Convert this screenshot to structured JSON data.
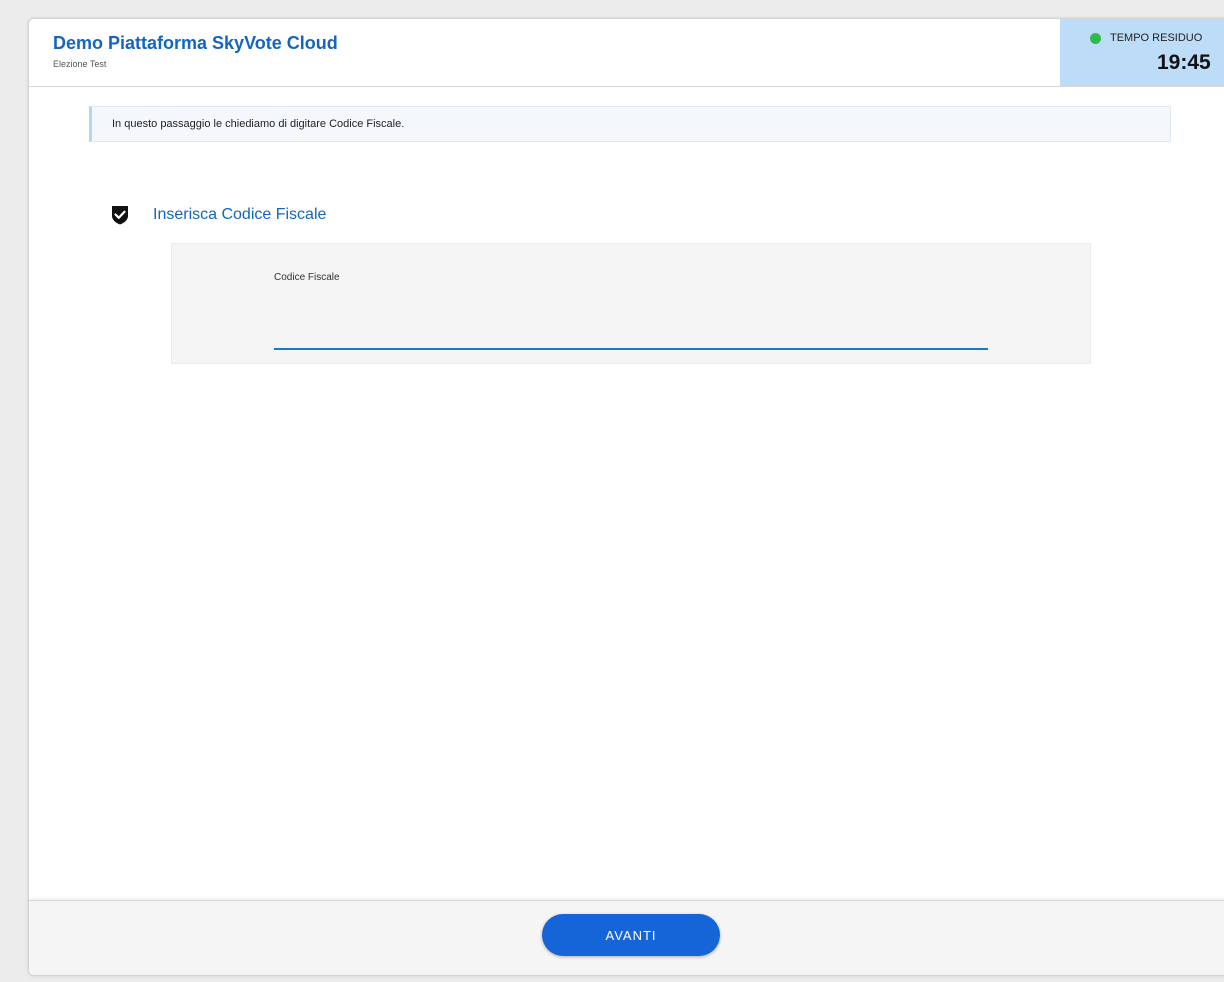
{
  "header": {
    "title": "Demo Piattaforma SkyVote Cloud",
    "subtitle": "Elezione Test"
  },
  "timer": {
    "label": "TEMPO RESIDUO",
    "value": "19:45",
    "status_color": "#2fba4f",
    "background_color": "#bcdcf7"
  },
  "info": {
    "text": "In questo passaggio le chiediamo di digitare Codice Fiscale."
  },
  "section": {
    "icon": "shield-check-icon",
    "title": "Inserisca Codice Fiscale"
  },
  "form": {
    "field_label": "Codice Fiscale",
    "field_value": "",
    "field_placeholder": ""
  },
  "footer": {
    "next_label": "AVANTI"
  },
  "colors": {
    "accent": "#1565c0",
    "button": "#1565d8"
  }
}
